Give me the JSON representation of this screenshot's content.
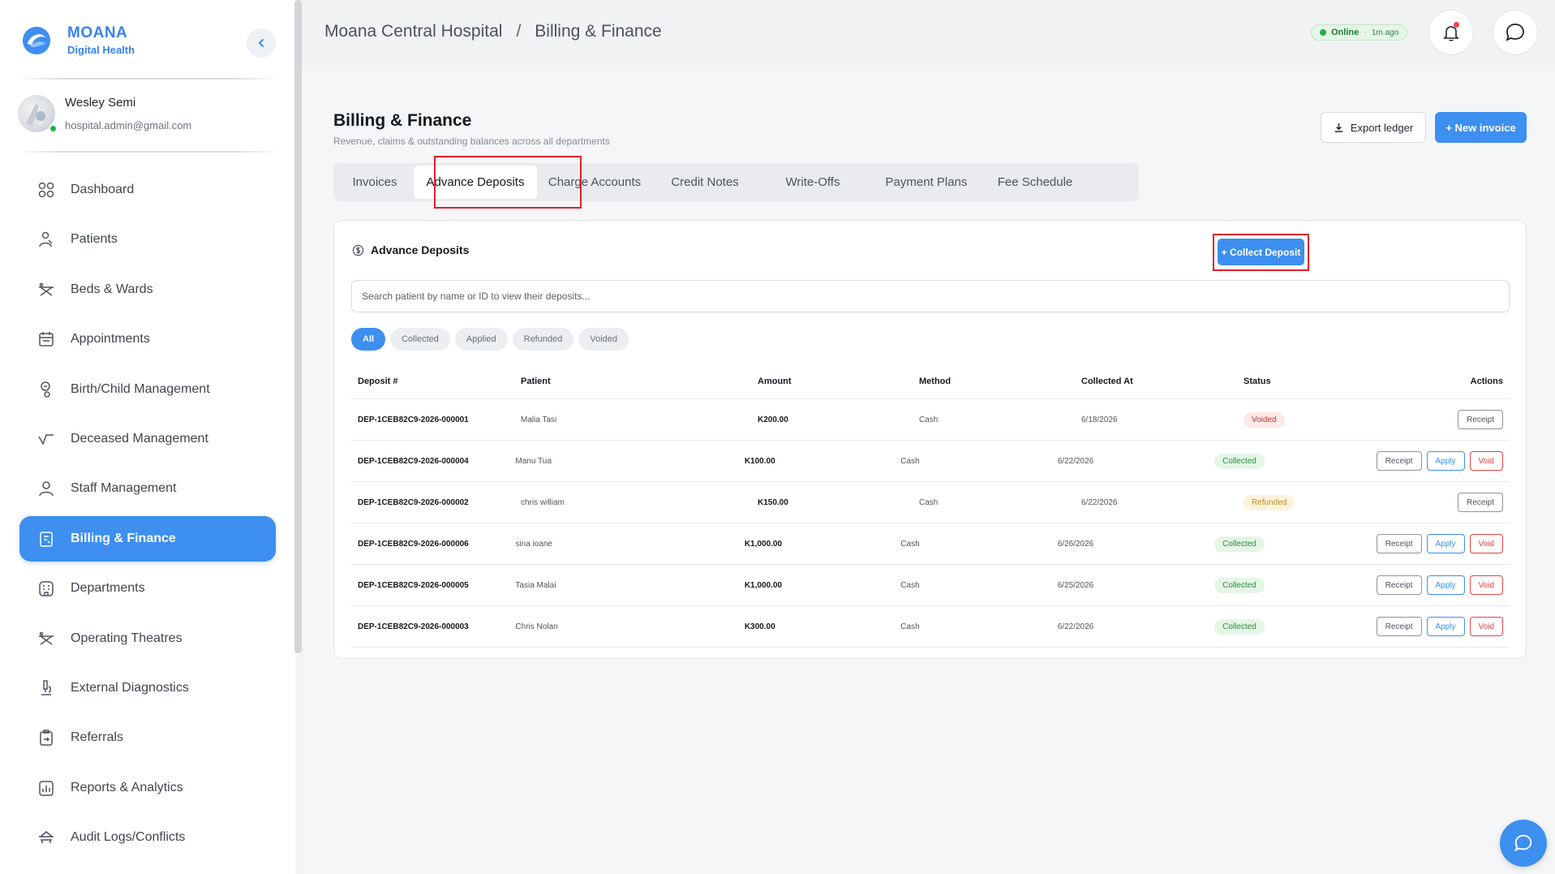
{
  "brand": {
    "name": "MOANA",
    "subtitle": "Digital Health"
  },
  "user": {
    "name": "Wesley Semi",
    "email": "hospital.admin@gmail.com"
  },
  "nav": {
    "items": [
      {
        "label": "Dashboard",
        "icon": "dashboard-icon"
      },
      {
        "label": "Patients",
        "icon": "patients-icon"
      },
      {
        "label": "Beds & Wards",
        "icon": "beds-icon"
      },
      {
        "label": "Appointments",
        "icon": "calendar-icon"
      },
      {
        "label": "Birth/Child Management",
        "icon": "birth-icon"
      },
      {
        "label": "Deceased Management",
        "icon": "deceased-icon"
      },
      {
        "label": "Staff Management",
        "icon": "staff-icon"
      },
      {
        "label": "Billing & Finance",
        "icon": "billing-icon",
        "active": true
      },
      {
        "label": "Departments",
        "icon": "departments-icon"
      },
      {
        "label": "Operating Theatres",
        "icon": "theatre-icon"
      },
      {
        "label": "External Diagnostics",
        "icon": "microscope-icon"
      },
      {
        "label": "Referrals",
        "icon": "referrals-icon"
      },
      {
        "label": "Reports & Analytics",
        "icon": "reports-icon"
      },
      {
        "label": "Audit Logs/Conflicts",
        "icon": "audit-icon"
      }
    ]
  },
  "header": {
    "breadcrumb": {
      "root": "Moana Central Hospital",
      "separator": "/",
      "current": "Billing & Finance"
    },
    "status": {
      "label": "Online",
      "separator": "·",
      "ago": "1m ago"
    }
  },
  "page": {
    "title": "Billing & Finance",
    "subtitle": "Revenue, claims & outstanding balances across all departments",
    "export_label": "Export ledger",
    "new_invoice_label": "+ New invoice"
  },
  "tabs": [
    {
      "label": "Invoices"
    },
    {
      "label": "Advance Deposits",
      "active": true
    },
    {
      "label": "Charge Accounts"
    },
    {
      "label": "Credit Notes"
    },
    {
      "label": "Write-Offs"
    },
    {
      "label": "Payment Plans"
    },
    {
      "label": "Fee Schedule"
    }
  ],
  "deposits": {
    "title": "Advance Deposits",
    "collect_label": "+ Collect Deposit",
    "search_placeholder": "Search patient by name or ID to view their deposits...",
    "filters": [
      "All",
      "Collected",
      "Applied",
      "Refunded",
      "Voided"
    ],
    "columns": [
      "Deposit #",
      "Patient",
      "Amount",
      "Method",
      "Collected At",
      "Status",
      "Actions"
    ],
    "rows": [
      {
        "id": "DEP-1CEB82C9-2026-000001",
        "patient": "Malia Tasi",
        "amount": "K200.00",
        "method": "Cash",
        "date": "6/18/2026",
        "status": "Voided",
        "actions": [
          "Receipt"
        ]
      },
      {
        "id": "DEP-1CEB82C9-2026-000004",
        "patient": "Manu Tua",
        "amount": "K100.00",
        "method": "Cash",
        "date": "6/22/2026",
        "status": "Collected",
        "actions": [
          "Receipt",
          "Apply",
          "Void"
        ]
      },
      {
        "id": "DEP-1CEB82C9-2026-000002",
        "patient": "chris william",
        "amount": "K150.00",
        "method": "Cash",
        "date": "6/22/2026",
        "status": "Refunded",
        "actions": [
          "Receipt"
        ]
      },
      {
        "id": "DEP-1CEB82C9-2026-000006",
        "patient": "sina ioane",
        "amount": "K1,000.00",
        "method": "Cash",
        "date": "6/26/2026",
        "status": "Collected",
        "actions": [
          "Receipt",
          "Apply",
          "Void"
        ]
      },
      {
        "id": "DEP-1CEB82C9-2026-000005",
        "patient": "Tasia Malai",
        "amount": "K1,000.00",
        "method": "Cash",
        "date": "6/25/2026",
        "status": "Collected",
        "actions": [
          "Receipt",
          "Apply",
          "Void"
        ]
      },
      {
        "id": "DEP-1CEB82C9-2026-000003",
        "patient": "Chris Nolan",
        "amount": "K300.00",
        "method": "Cash",
        "date": "6/22/2026",
        "status": "Collected",
        "actions": [
          "Receipt",
          "Apply",
          "Void"
        ]
      }
    ]
  },
  "colors": {
    "accent": "#3d8ff0",
    "highlight": "#e0202a",
    "online": "#21b04b"
  }
}
